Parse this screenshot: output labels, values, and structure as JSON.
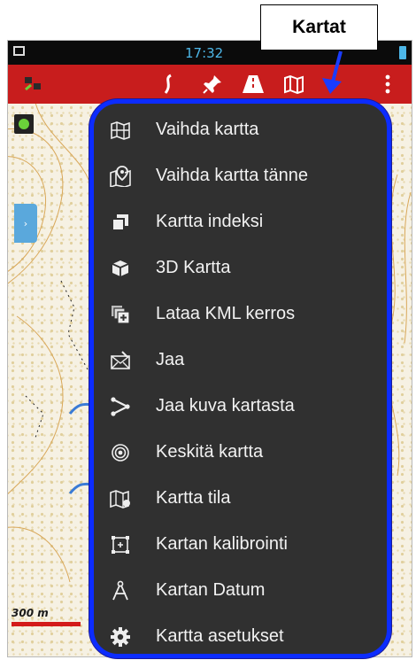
{
  "status_bar": {
    "time": "17:32"
  },
  "map": {
    "scale_label": "300 m"
  },
  "callout": {
    "label": "Kartat"
  },
  "colors": {
    "toolbar": "#c81d1d",
    "menu_border": "#0c2cff",
    "menu_bg": "#303030",
    "status_accent": "#4db7e8"
  },
  "menu": {
    "items": [
      {
        "label": "Vaihda kartta",
        "icon": "map-icon"
      },
      {
        "label": "Vaihda kartta tänne",
        "icon": "map-pin-icon"
      },
      {
        "label": "Kartta indeksi",
        "icon": "layers-icon"
      },
      {
        "label": "3D Kartta",
        "icon": "cube-icon"
      },
      {
        "label": "Lataa KML kerros",
        "icon": "kml-layer-icon"
      },
      {
        "label": "Jaa",
        "icon": "mail-icon"
      },
      {
        "label": "Jaa kuva kartasta",
        "icon": "share-icon"
      },
      {
        "label": "Keskitä kartta",
        "icon": "target-icon"
      },
      {
        "label": "Kartta tila",
        "icon": "map-mode-icon"
      },
      {
        "label": "Kartan kalibrointi",
        "icon": "calibration-icon"
      },
      {
        "label": "Kartan Datum",
        "icon": "compass-icon"
      },
      {
        "label": "Kartta asetukset",
        "icon": "gear-icon"
      }
    ]
  }
}
